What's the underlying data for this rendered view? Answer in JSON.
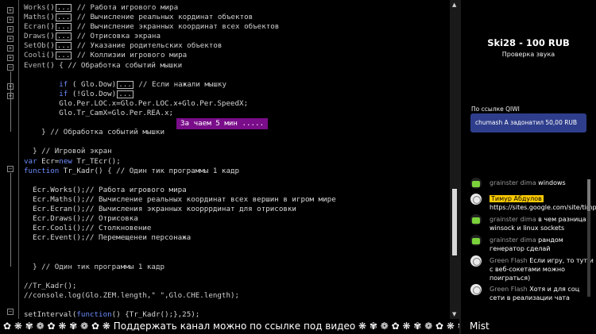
{
  "editor": {
    "lines": [
      [
        {
          "t": "Works",
          "c": "fn"
        },
        {
          "t": "()",
          "c": ""
        },
        {
          "t": "...",
          "c": "dots"
        },
        {
          "t": " // Работа игрового мира",
          "c": "cm"
        }
      ],
      [
        {
          "t": "Maths",
          "c": "fn"
        },
        {
          "t": "()",
          "c": ""
        },
        {
          "t": "...",
          "c": "dots"
        },
        {
          "t": " // Вычисление реальных кординат объектов",
          "c": "cm"
        }
      ],
      [
        {
          "t": "Ecran",
          "c": "fn"
        },
        {
          "t": "()",
          "c": ""
        },
        {
          "t": "...",
          "c": "dots"
        },
        {
          "t": " // Вычисление экранных координат всех объектов",
          "c": "cm"
        }
      ],
      [
        {
          "t": "Draws",
          "c": "fn"
        },
        {
          "t": "()",
          "c": ""
        },
        {
          "t": "...",
          "c": "dots"
        },
        {
          "t": " // Отрисовка экрана",
          "c": "cm"
        }
      ],
      [
        {
          "t": "SetOb",
          "c": "fn"
        },
        {
          "t": "()",
          "c": ""
        },
        {
          "t": "...",
          "c": "dots"
        },
        {
          "t": " // Указание родительских объектов",
          "c": "cm"
        }
      ],
      [
        {
          "t": "Cooli",
          "c": "fn"
        },
        {
          "t": "()",
          "c": ""
        },
        {
          "t": "...",
          "c": "dots"
        },
        {
          "t": " // Коллизии игрового мира",
          "c": "cm"
        }
      ],
      [
        {
          "t": "Event",
          "c": "fn"
        },
        {
          "t": "() { // Обработка событий мышки",
          "c": "cm"
        }
      ],
      [],
      [
        {
          "t": "        ",
          "c": ""
        },
        {
          "t": "if",
          "c": "kw"
        },
        {
          "t": " ( Glo.Dow)",
          "c": ""
        },
        {
          "t": "...",
          "c": "dots"
        },
        {
          "t": " // Если нажали мышку",
          "c": "cm"
        }
      ],
      [
        {
          "t": "        ",
          "c": ""
        },
        {
          "t": "if",
          "c": "kw"
        },
        {
          "t": " (!Glo.Dow)",
          "c": ""
        },
        {
          "t": "...",
          "c": "dots"
        }
      ],
      [
        {
          "t": "        Glo.Per.LOC.x=Glo.Per.LOC.x+Glo.Per.SpeedX;",
          "c": ""
        }
      ],
      [
        {
          "t": "        Glo.Tr_CamX=Glo.Per.REA.x;",
          "c": ""
        }
      ],
      [],
      [
        {
          "t": "    } // Обработка событий мышки",
          "c": "cm"
        }
      ],
      [],
      [
        {
          "t": "  } // Игровой экран",
          "c": "cm"
        }
      ],
      [
        {
          "t": "var",
          "c": "kw"
        },
        {
          "t": " Ecr=",
          "c": ""
        },
        {
          "t": "new",
          "c": "kw"
        },
        {
          "t": " Tr_TEcr();",
          "c": ""
        }
      ],
      [
        {
          "t": "function",
          "c": "kw"
        },
        {
          "t": " Tr_Kadr() { // Один тик программы 1 кадр",
          "c": ""
        }
      ],
      [],
      [
        {
          "t": "  Ecr.Works();// Работа игрового мира",
          "c": ""
        }
      ],
      [
        {
          "t": "  Ecr.Maths();// Вычисление реальных координат всех вершин в игром мире",
          "c": ""
        }
      ],
      [
        {
          "t": "  Ecr.Ecran();// Вычисления экранных коорррдинат для отрисовки",
          "c": ""
        }
      ],
      [
        {
          "t": "  Ecr.Draws();// Отрисовка",
          "c": ""
        }
      ],
      [
        {
          "t": "  Ecr.Cooli();// Столкновение",
          "c": ""
        }
      ],
      [
        {
          "t": "  Ecr.Event();// Перемещенеи персонажа",
          "c": ""
        }
      ],
      [],
      [],
      [
        {
          "t": "  } // Один тик программы 1 кадр",
          "c": "cm"
        }
      ],
      [],
      [
        {
          "t": "//Tr_Kadr();",
          "c": "cm"
        }
      ],
      [
        {
          "t": "//console.log(Glo.ZEM.length,\" \",Glo.CHE.length);",
          "c": "cm"
        }
      ],
      [],
      [
        {
          "t": "setInterval(",
          "c": ""
        },
        {
          "t": "function",
          "c": "kw"
        },
        {
          "t": "() {Tr_Kadr();},25);",
          "c": ""
        }
      ]
    ],
    "tooltip": "За чаем 5 мин ....."
  },
  "ticker": {
    "text": "✿ ❋ ✾ ❁ ✿ ❋ ✾ ❁ ✿ ❋  Поддержать канал можно по ссылке под видео  ❋ ✾ ❁ ✿ ❋ ✾ ❁ ✿ ❋ ✾"
  },
  "right_panel": {
    "donation_title": "Ski28 - 100 RUB",
    "donation_subtitle": "Проверка звука",
    "qiwi_label": "По ссылке QIWI",
    "qiwi_message": "chumash A задонатил 50,00 RUB",
    "chat": [
      {
        "user": "grainster dima",
        "text": "windows",
        "avatar": "green",
        "highlight": false
      },
      {
        "user": "Тимур Абдулов",
        "text": "https://sites.google.com/site/timpasc...",
        "avatar": "white",
        "highlight": true
      },
      {
        "user": "grainster dima",
        "text": "в чем разница winsock и linux sockets",
        "avatar": "green",
        "highlight": false
      },
      {
        "user": "grainster dima",
        "text": "рандом генератор сделай",
        "avatar": "green",
        "highlight": false
      },
      {
        "user": "Green Flash",
        "text": "Если игру, то тут и с веб-сокетами можно поиграться)",
        "avatar": "white",
        "highlight": false
      },
      {
        "user": "Green Flash",
        "text": "Хотя и для соц сети в реализации чата",
        "avatar": "white",
        "highlight": false
      }
    ],
    "footer_name": "Mist"
  },
  "colors": {
    "keyword": "#6d8cff",
    "tooltip_bg": "#7a0d8a",
    "qiwi_bg": "#2f3e8c",
    "highlight_user": "#ffcc00"
  }
}
